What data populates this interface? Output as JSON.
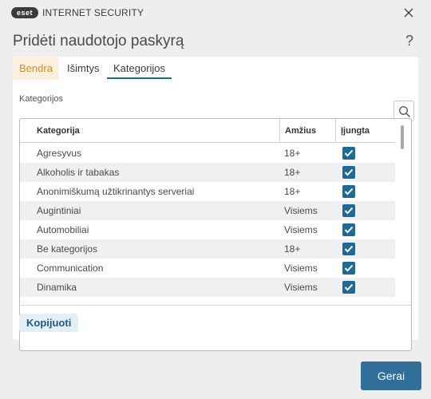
{
  "window": {
    "logo_text": "eset",
    "product_name": "INTERNET SECURITY",
    "close_glyph": "×"
  },
  "dialog": {
    "title": "Pridėti naudotojo paskyrą",
    "help_glyph": "?"
  },
  "tabs": [
    {
      "label": "Bendra",
      "state": "highlighted"
    },
    {
      "label": "Išimtys",
      "state": "normal"
    },
    {
      "label": "Kategorijos",
      "state": "selected"
    }
  ],
  "section_label": "Kategorijos",
  "table": {
    "headers": [
      "Kategorija",
      "Amžius",
      "Įjungta"
    ],
    "rows": [
      {
        "category": "Agresyvus",
        "age": "18+",
        "enabled": true
      },
      {
        "category": "Alkoholis ir tabakas",
        "age": "18+",
        "enabled": true
      },
      {
        "category": "Anonimiškumą užtikrinantys serveriai",
        "age": "18+",
        "enabled": true
      },
      {
        "category": "Augintiniai",
        "age": "Visiems",
        "enabled": true
      },
      {
        "category": "Automobiliai",
        "age": "Visiems",
        "enabled": true
      },
      {
        "category": "Be kategorijos",
        "age": "18+",
        "enabled": true
      },
      {
        "category": "Communication",
        "age": "Visiems",
        "enabled": true
      },
      {
        "category": "Dinamika",
        "age": "Visiems",
        "enabled": true
      }
    ]
  },
  "buttons": {
    "copy": "Kopijuoti",
    "ok": "Gerai"
  },
  "icons": {
    "close": "close-icon",
    "help": "help-icon",
    "search": "search-icon",
    "checkbox": "checkmark-icon"
  },
  "colors": {
    "accent": "#1d6a96",
    "primary_button": "#2f6f99",
    "highlight_tab_bg": "#fdf1dd",
    "highlight_tab_text": "#d98a1c"
  }
}
